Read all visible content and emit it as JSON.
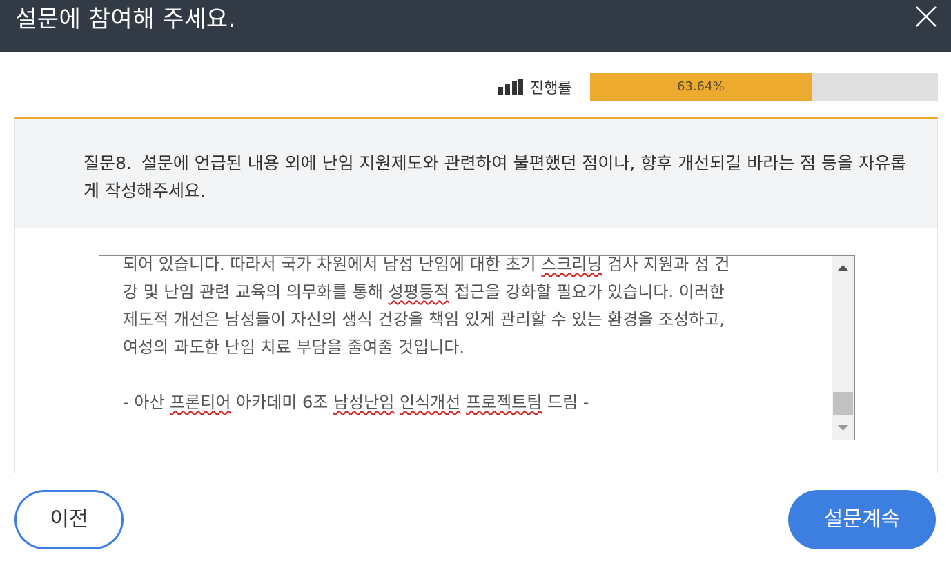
{
  "header": {
    "title": "설문에 참여해 주세요.",
    "close_icon": "close-icon"
  },
  "progress": {
    "icon": "bar-chart-icon",
    "label": "진행률",
    "percent_text": "63.64%",
    "value": 63.64,
    "fill_color": "#ecab2f",
    "track_color": "#e0e0e0"
  },
  "question": {
    "number": "질문8.",
    "text": "설문에 언급된 내용 외에 난임 지원제도와 관련하여 불편했던 점이나, 향후 개선되길 바라는 점 등을 자유롭게 작성해주세요."
  },
  "answer": {
    "lines": [
      [
        {
          "t": "되어 있습니다. 따라서 국가 차원에서 남성 난임에 대한 초기 "
        },
        {
          "t": "스크리닝",
          "err": true
        },
        {
          "t": " 검사 지원과 성 건"
        }
      ],
      [
        {
          "t": "강 및 난임 관련 교육의 의무화를 통해 "
        },
        {
          "t": "성평등적",
          "err": true
        },
        {
          "t": " 접근을 강화할 필요가 있습니다. 이러한"
        }
      ],
      [
        {
          "t": "제도적 개선은 남성들이 자신의 생식 건강을 책임 있게 관리할 수 있는 환경을 조성하고,"
        }
      ],
      [
        {
          "t": "여성의 과도한 난임 치료 부담을 줄여줄 것입니다."
        }
      ],
      [
        {
          "t": ""
        }
      ],
      [
        {
          "t": "- 아산 "
        },
        {
          "t": "프론티어",
          "err": true
        },
        {
          "t": " 아카데미 6조 "
        },
        {
          "t": "남성난임",
          "err": true
        },
        {
          "t": " "
        },
        {
          "t": "인식개선",
          "err": true
        },
        {
          "t": " "
        },
        {
          "t": "프로젝트팀",
          "err": true
        },
        {
          "t": " 드림 -"
        }
      ]
    ],
    "scroll_up_icon": "scroll-up-arrow-icon",
    "scroll_down_icon": "scroll-down-arrow-icon"
  },
  "buttons": {
    "prev_label": "이전",
    "next_label": "설문계속"
  },
  "colors": {
    "header_bg": "#323b45",
    "accent": "#ecab2f",
    "primary": "#3c7fe0",
    "question_bg": "#f3f4f6"
  }
}
